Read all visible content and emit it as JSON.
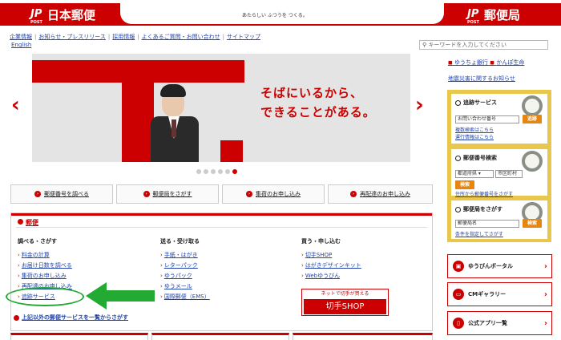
{
  "header": {
    "left_logo_mark": "JP",
    "left_logo_post": "POST",
    "left_name": "日本郵便",
    "tagline": "あたらしい ふつうを つくる。",
    "right_logo_mark": "JP",
    "right_logo_post": "POST",
    "right_name": "郵便局"
  },
  "util_nav": {
    "links": [
      "企業情報",
      "お知らせ・プレスリリース",
      "採用情報",
      "よくあるご質問・お問い合わせ",
      "サイトマップ"
    ],
    "english": "English"
  },
  "search": {
    "placeholder": "キーワードを入力してください"
  },
  "hero": {
    "copy_line1": "そばにいるから、",
    "copy_line2": "できることがある。",
    "prev_icon": "chevron-left-icon",
    "next_icon": "chevron-right-icon",
    "slides_total": 6,
    "active_slide": 6
  },
  "quick_buttons": [
    "郵便番号を調べる",
    "郵便局をさがす",
    "集荷のお申し込み",
    "再配達のお申し込み"
  ],
  "post_section": {
    "title": "郵便",
    "col1": {
      "heading": "調べる・さがす",
      "links": [
        "料金の計算",
        "お届け日数を調べる",
        "集荷のお申し込み",
        "再配達のお申し込み",
        "追跡サービス"
      ]
    },
    "col2": {
      "heading": "送る・受け取る",
      "links": [
        "手紙・はがき",
        "レターパック",
        "ゆうパック",
        "ゆうメール",
        "国際郵便（EMS）"
      ]
    },
    "col3": {
      "heading": "買う・申し込む",
      "links": [
        "切手SHOP",
        "はがきデザインキット",
        "Webゆうびん"
      ]
    },
    "stamp_banner_top": "ネットで切手が買える",
    "stamp_banner_main": "切手SHOP",
    "all_services": "上記以外の郵便サービスを一覧からさがす"
  },
  "sidebar": {
    "bank_links": [
      "ゆうちょ銀行",
      "かんぽ生命"
    ],
    "disaster": "地震災害に関するお知らせ",
    "tracking": {
      "title": "追跡サービス",
      "input_value": "お問い合わせ番号",
      "button": "追跡",
      "link1": "複数検索はこちら",
      "link2": "運行情報はこちら"
    },
    "zipcode": {
      "title": "郵便番号検索",
      "select_value": "都道府県",
      "input_value": "市区町村",
      "button": "検索",
      "link": "住所から郵便番号をさがす"
    },
    "office": {
      "title": "郵便局をさがす",
      "input_value": "郵便局名",
      "button": "検索",
      "link": "条件を指定してさがす"
    },
    "portal_buttons": [
      "ゆうびんポータル",
      "CMギャラリー",
      "公式アプリ一覧"
    ]
  },
  "colors": {
    "brand_red": "#cc0000",
    "sidebar_gold": "#e9c64c",
    "orange_button": "#e8850c",
    "annotation_green": "#22aa33"
  }
}
